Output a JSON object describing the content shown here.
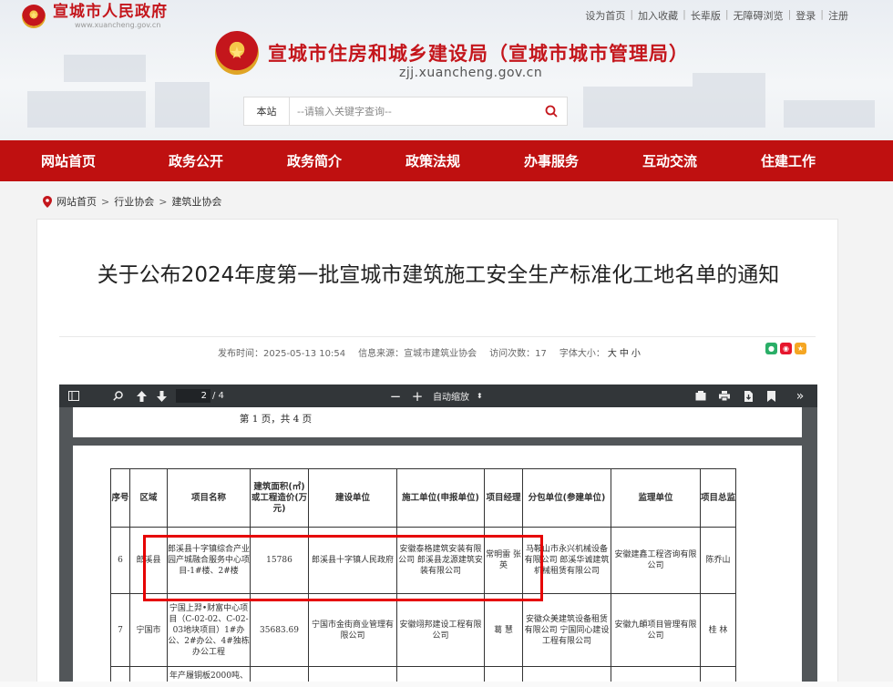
{
  "gov": {
    "name": "宣城市人民政府",
    "domain": "www.xuancheng.gov.cn"
  },
  "toplinks": [
    "设为首页",
    "加入收藏",
    "长辈版",
    "无障碍浏览",
    "登录",
    "注册"
  ],
  "site": {
    "title": "宣城市住房和城乡建设局（宣城市城市管理局）",
    "domain": "zjj.xuancheng.gov.cn"
  },
  "search": {
    "scope": "本站",
    "placeholder": "--请输入关键字查询--"
  },
  "nav": [
    "网站首页",
    "政务公开",
    "政务简介",
    "政策法规",
    "办事服务",
    "互动交流",
    "住建工作"
  ],
  "breadcrumb": [
    "网站首页",
    "行业协会",
    "建筑业协会"
  ],
  "article": {
    "title": "关于公布2024年度第一批宣城市建筑施工安全生产标准化工地名单的通知",
    "publish_time": "发布时间：2025-05-13 10:54",
    "source": "信息来源：宣城市建筑业协会",
    "visits": "访问次数：17",
    "font_size_label": "字体大小：",
    "font_sizes": [
      "大",
      "中",
      "小"
    ]
  },
  "viewer": {
    "page_current": "2",
    "page_total": "/ 4",
    "zoom": "自动缩放",
    "page_label": "第 1 页，共 4 页"
  },
  "table": {
    "headers": [
      "序号",
      "区域",
      "项目名称",
      "建筑面积(㎡)或工程造价(万元)",
      "建设单位",
      "施工单位(申报单位)",
      "项目经理",
      "分包单位(参建单位)",
      "监理单位",
      "项目总监"
    ],
    "rows": [
      [
        "6",
        "郎溪县",
        "郎溪县十字镇综合产业园产城融合服务中心项目-1#楼、2#楼",
        "15786",
        "郎溪县十字镇人民政府",
        "安徽泰格建筑安装有限公司 郎溪县龙源建筑安装有限公司",
        "常明雷 张英",
        "马鞍山市永兴机械设备有限公司 郎溪华诚建筑机械租赁有限公司",
        "安徽建鑫工程咨询有限公司",
        "陈乔山"
      ],
      [
        "7",
        "宁国市",
        "宁国上羿•财富中心项目（C-02-02、C-02-03地块项目）1#办公、2#办公、4#独栋办公工程",
        "35683.69",
        "宁国市金街商业管理有限公司",
        "安徽翊邦建设工程有限公司",
        "葛 慧",
        "安徽众美建筑设备租赁有限公司 宁国同心建设工程有限公司",
        "安徽九頔项目管理有限公司",
        "桂 林"
      ],
      [
        "",
        "",
        "年产履铜板2000吨、",
        "",
        "",
        "",
        "",
        "",
        "",
        ""
      ]
    ]
  }
}
